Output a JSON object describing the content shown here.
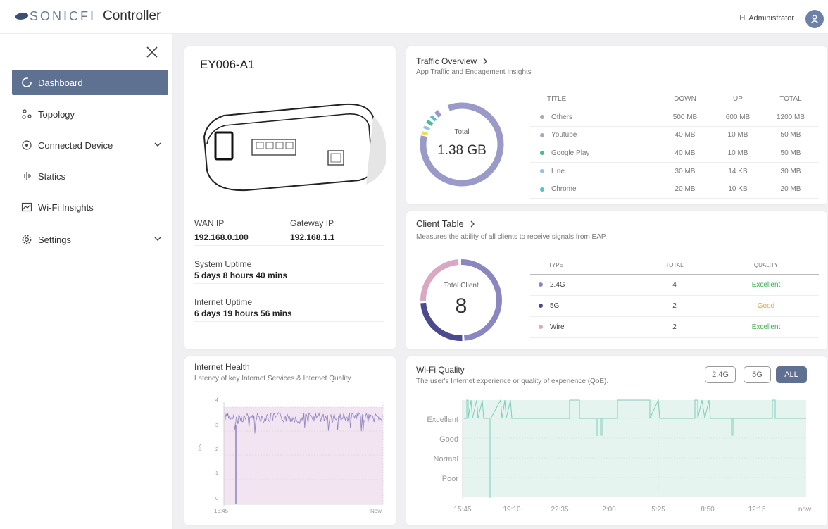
{
  "app": {
    "brand": "SONICFI",
    "title": "Controller",
    "greeting": "Hi Administrator"
  },
  "sidebar": {
    "items": [
      {
        "label": "Dashboard",
        "icon": "dashboard-icon",
        "active": true
      },
      {
        "label": "Topology",
        "icon": "topology-icon"
      },
      {
        "label": "Connected Device",
        "icon": "connected-device-icon",
        "expandable": true
      },
      {
        "label": "Statics",
        "icon": "statics-icon"
      },
      {
        "label": "Wi-Fi Insights",
        "icon": "wifi-insights-icon"
      },
      {
        "label": "Settings",
        "icon": "gear-icon",
        "expandable": true
      }
    ]
  },
  "device": {
    "name": "EY006-A1",
    "wan_ip_label": "WAN IP",
    "wan_ip": "192.168.0.100",
    "gateway_ip_label": "Gateway IP",
    "gateway_ip": "192.168.1.1",
    "system_uptime_label": "System Uptime",
    "system_uptime": "5 days 8 hours 40 mins",
    "internet_uptime_label": "Internet Uptime",
    "internet_uptime": "6 days 19 hours 56 mins"
  },
  "traffic": {
    "title": "Traffic Overview",
    "subtitle": "App Traffic and Engagement Insights",
    "total_label": "Total",
    "total_value": "1.38 GB",
    "headers": [
      "TITLE",
      "DOWN",
      "UP",
      "TOTAL"
    ],
    "rows": [
      {
        "name": "Others",
        "down": "500 MB",
        "up": "600 MB",
        "total": "1200 MB",
        "color": "#a8aab8"
      },
      {
        "name": "Youtube",
        "down": "40 MB",
        "up": "10 MB",
        "total": "50 MB",
        "color": "#a8aab8"
      },
      {
        "name": "Google Play",
        "down": "40 MB",
        "up": "10 MB",
        "total": "50 MB",
        "color": "#4db89a"
      },
      {
        "name": "Line",
        "down": "30 MB",
        "up": "14 KB",
        "total": "30 MB",
        "color": "#8ec5e8"
      },
      {
        "name": "Chrome",
        "down": "20 MB",
        "up": "10 KB",
        "total": "20 MB",
        "color": "#5bbec8"
      }
    ]
  },
  "clients": {
    "title": "Client Table",
    "subtitle": "Measures the ability of all clients to receive signals from EAP.",
    "total_label": "Total Client",
    "total_value": "8",
    "headers": [
      "TYPE",
      "TOTAL",
      "QUALITY"
    ],
    "rows": [
      {
        "type": "2.4G",
        "total": "4",
        "quality": "Excellent",
        "color": "#8a86c0",
        "quality_color": "#3fae4f"
      },
      {
        "type": "5G",
        "total": "2",
        "quality": "Good",
        "color": "#4c4a8e",
        "quality_color": "#e8a640"
      },
      {
        "type": "Wire",
        "total": "2",
        "quality": "Excellent",
        "color": "#d9a9c4",
        "quality_color": "#3fae4f"
      }
    ]
  },
  "health": {
    "title": "Internet Health",
    "subtitle": "Latency of key Internet Services & Internet Quality",
    "y_label": "ms",
    "y_ticks": [
      "4",
      "3",
      "2",
      "1",
      "0"
    ],
    "x_start": "15:45",
    "x_end": "Now"
  },
  "wifi": {
    "title": "Wi-Fi Quality",
    "subtitle": "The user's Internet experience or quality of experience (QoE).",
    "buttons": [
      "2.4G",
      "5G",
      "ALL"
    ],
    "selected": "ALL",
    "y_ticks": [
      "Excellent",
      "Good",
      "Normal",
      "Poor"
    ],
    "x_ticks": [
      "15:45",
      "19:10",
      "22:35",
      "2:00",
      "5:25",
      "8:50",
      "12:15",
      "now"
    ]
  },
  "colors": {
    "accent": "#5f7190",
    "traffic_ring": "#9a9ac8",
    "health_fill": "#f2e4f0",
    "wifi_fill": "#e6f4f0"
  }
}
